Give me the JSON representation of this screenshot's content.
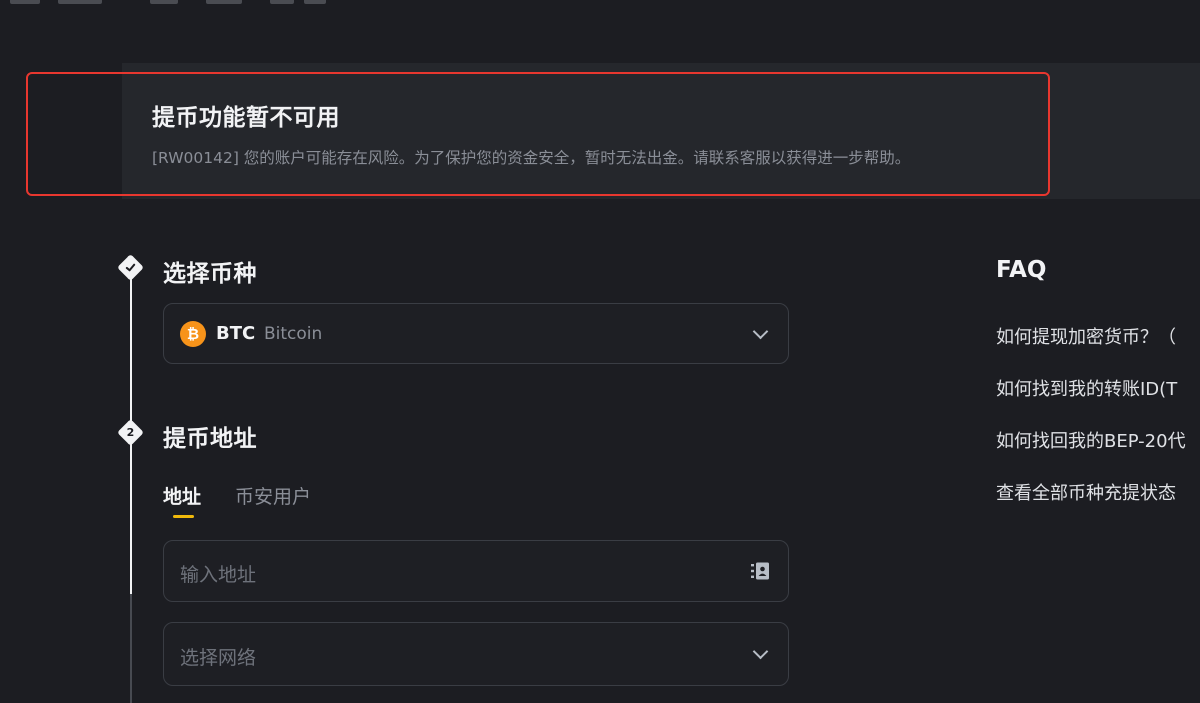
{
  "alert": {
    "title": "提币功能暂不可用",
    "message": "[RW00142] 您的账户可能存在风险。为了保护您的资金安全，暂时无法出金。请联系客服以获得进一步帮助。"
  },
  "steps": [
    {
      "number": "1",
      "status": "completed",
      "title": "选择币种",
      "coin": {
        "symbol": "BTC",
        "name": "Bitcoin",
        "icon": "bitcoin-icon",
        "icon_glyph": "₿",
        "color": "#f7931a"
      }
    },
    {
      "number": "2",
      "status": "active",
      "title": "提币地址",
      "tabs": [
        {
          "label": "地址",
          "active": true
        },
        {
          "label": "币安用户",
          "active": false
        }
      ],
      "address_placeholder": "输入地址",
      "network_placeholder": "选择网络"
    }
  ],
  "faq": {
    "title": "FAQ",
    "items": [
      "如何提现加密货币？（",
      "如何找到我的转账ID(T",
      "如何找回我的BEP-20代",
      "查看全部币种充提状态"
    ]
  },
  "colors": {
    "background": "#1c1d22",
    "accent": "#f0b90b",
    "alert_outline": "#e8372f"
  }
}
